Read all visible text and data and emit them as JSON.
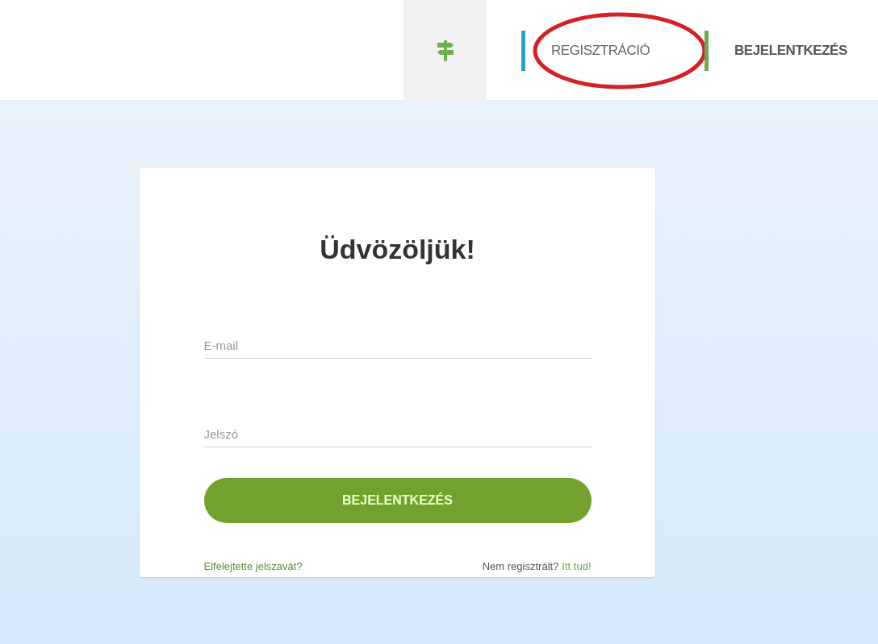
{
  "nav": {
    "tabs": [
      {
        "kind": "icon",
        "selected": true
      },
      {
        "kind": "text",
        "label": "REGISZTRÁCIÓ",
        "selected": false,
        "color": "#2a9fd0",
        "highlighted": true
      },
      {
        "kind": "text",
        "label": "BEJELENTKEZÉS",
        "selected": false,
        "color": "#6aaa4a",
        "highlighted": false
      }
    ]
  },
  "login": {
    "title": "Üdvözöljük!",
    "fields": [
      {
        "placeholder": "E-mail"
      },
      {
        "placeholder": "Jelszó"
      }
    ],
    "submit": "BEJELENTKEZÉS",
    "forgot": "Elfelejtette jelszavát?",
    "register_prompt": {
      "text": "Nem regisztrált?",
      "link": "Itt tud!"
    }
  }
}
